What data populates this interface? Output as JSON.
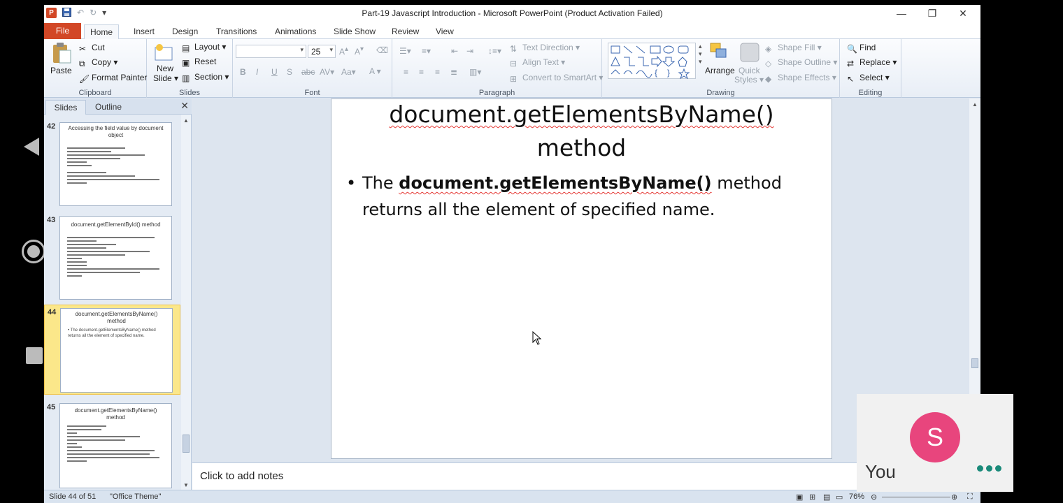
{
  "window": {
    "title": "Part-19 Javascript Introduction  -  Microsoft PowerPoint (Product Activation Failed)"
  },
  "ribbon_tabs": [
    "File",
    "Home",
    "Insert",
    "Design",
    "Transitions",
    "Animations",
    "Slide Show",
    "Review",
    "View"
  ],
  "ribbon": {
    "clipboard": {
      "label": "Clipboard",
      "paste": "Paste",
      "cut": "Cut",
      "copy": "Copy",
      "format_painter": "Format Painter"
    },
    "slides": {
      "label": "Slides",
      "new_slide_1": "New",
      "new_slide_2": "Slide",
      "layout": "Layout",
      "reset": "Reset",
      "section": "Section"
    },
    "font": {
      "label": "Font",
      "size": "25"
    },
    "paragraph": {
      "label": "Paragraph",
      "text_direction": "Text Direction",
      "align_text": "Align Text",
      "convert_smartart": "Convert to SmartArt"
    },
    "drawing": {
      "label": "Drawing",
      "arrange": "Arrange",
      "quick_styles_1": "Quick",
      "quick_styles_2": "Styles",
      "shape_fill": "Shape Fill",
      "shape_outline": "Shape Outline",
      "shape_effects": "Shape Effects"
    },
    "editing": {
      "label": "Editing",
      "find": "Find",
      "replace": "Replace",
      "select": "Select"
    }
  },
  "pane": {
    "tab_slides": "Slides",
    "tab_outline": "Outline",
    "thumbs": [
      {
        "num": "42",
        "title": "Accessing the field value by document object"
      },
      {
        "num": "43",
        "title": "document.getElementById() method"
      },
      {
        "num": "44",
        "title": "document.getElementsByName() method",
        "body": "• The document.getElementsByName() method returns all the element of specified name."
      },
      {
        "num": "45",
        "title": "document.getElementsByName() method"
      }
    ]
  },
  "slide": {
    "title_line1": "document.getElementsByName()",
    "title_line2": "method",
    "bullet_prefix": "The ",
    "bullet_bold": "document.getElementsByName()",
    "bullet_suffix": "  method returns all the element of specified name."
  },
  "notes_placeholder": "Click to add notes",
  "status": {
    "slide_info": "Slide 44 of 51",
    "theme": "\"Office Theme\"",
    "zoom": "76%"
  },
  "participant": {
    "initial": "S",
    "name": "You"
  },
  "colors": {
    "file_tab": "#d24726",
    "avatar": "#e8457d",
    "selection": "#fbe78a"
  }
}
